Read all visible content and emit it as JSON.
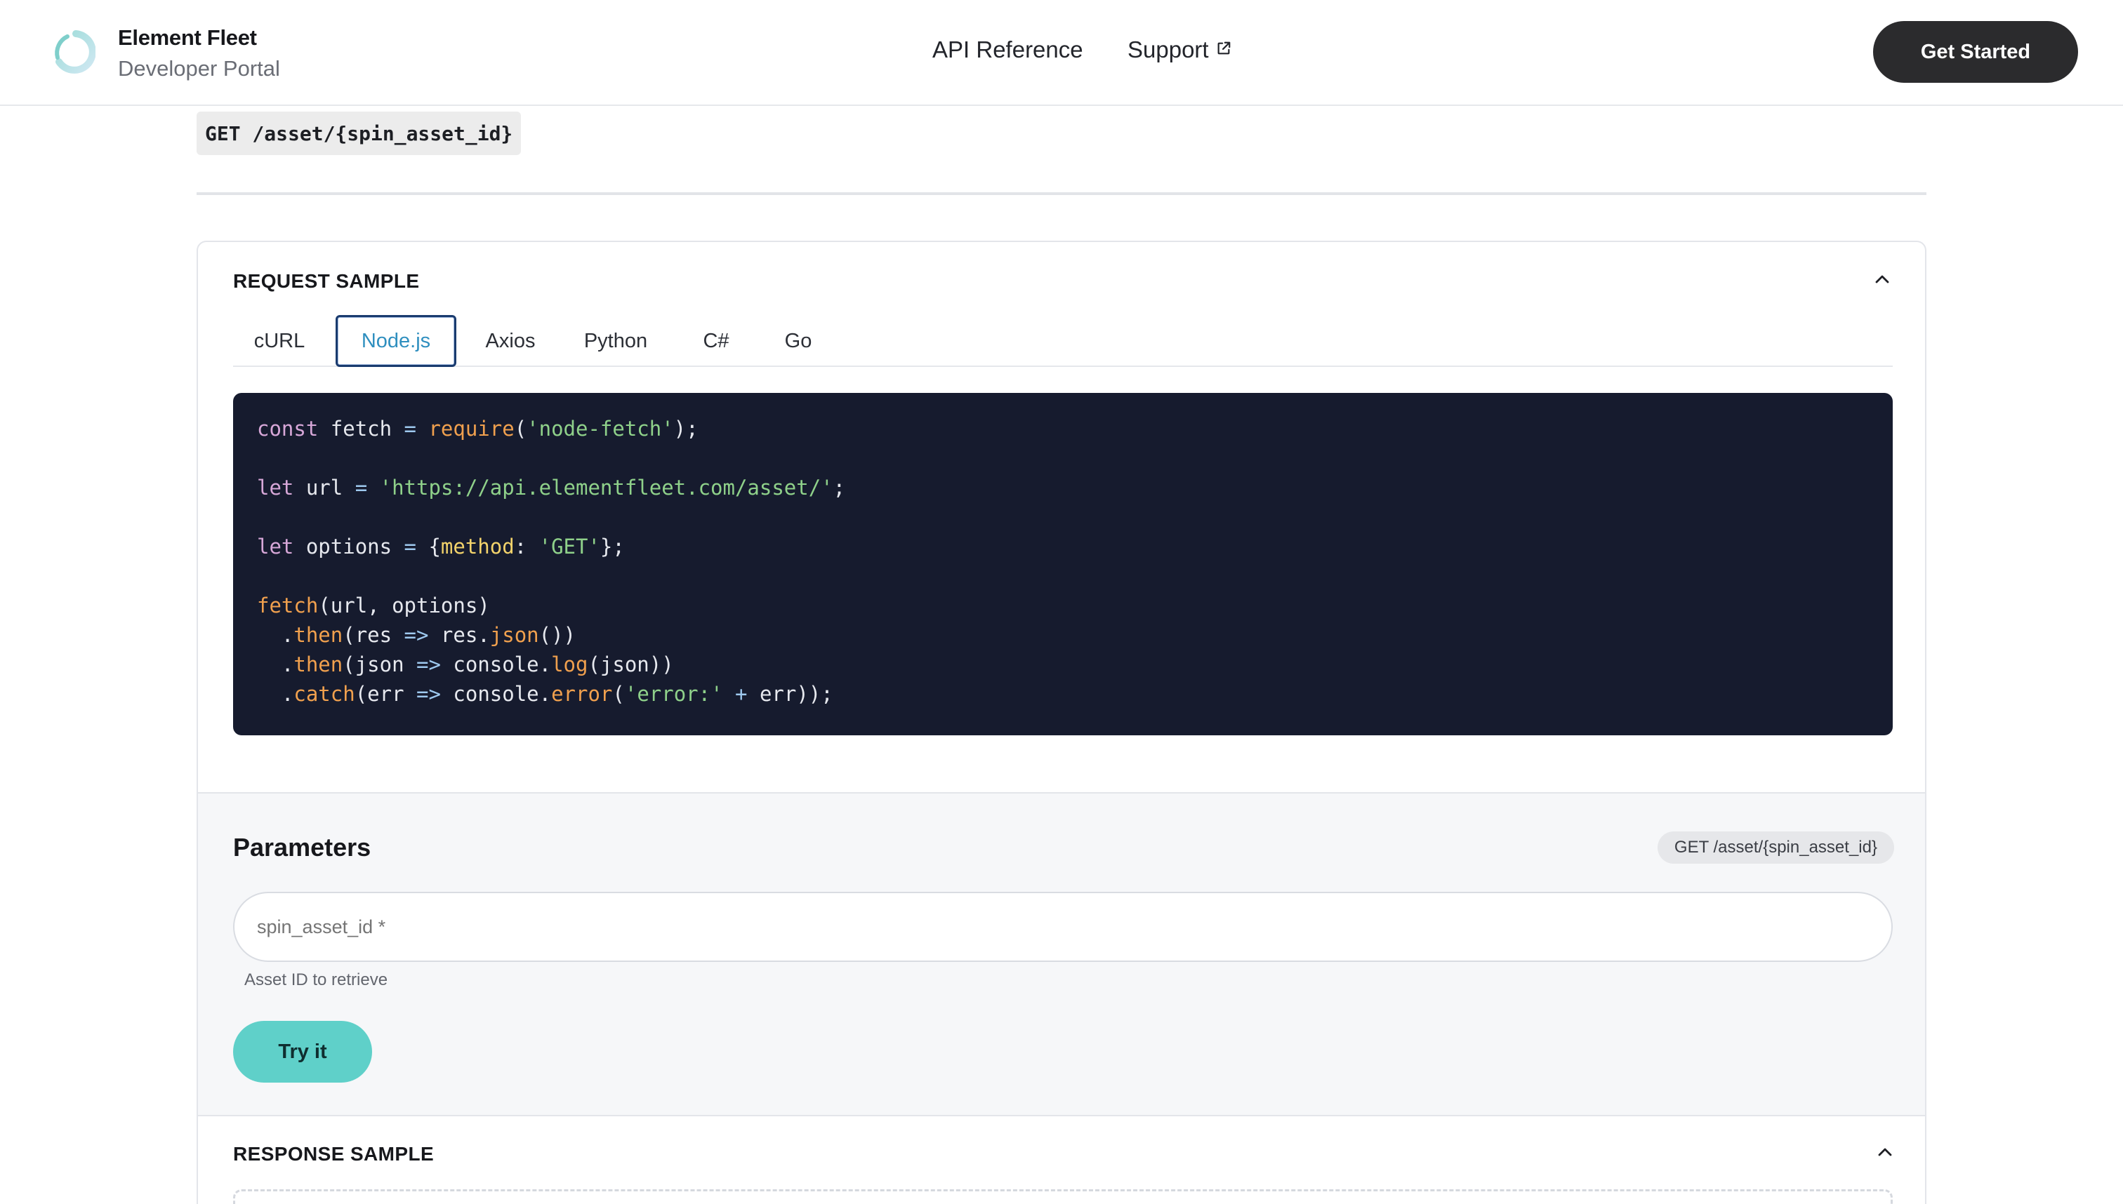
{
  "header": {
    "brand_title": "Element Fleet",
    "brand_subtitle": "Developer Portal",
    "nav": [
      {
        "label": "API Reference"
      },
      {
        "label": "Support",
        "icon": "external-link-icon"
      }
    ],
    "cta_label": "Get Started"
  },
  "endpoint": {
    "label": "GET /asset/{spin_asset_id}"
  },
  "request_sample": {
    "title": "REQUEST SAMPLE",
    "collapse_icon": "chevron-up-icon",
    "tabs": [
      {
        "label": "cURL",
        "active": false
      },
      {
        "label": "Node.js",
        "active": true
      },
      {
        "label": "Axios",
        "active": false
      },
      {
        "label": "Python",
        "active": false
      },
      {
        "label": "C#",
        "active": false
      },
      {
        "label": "Go",
        "active": false
      }
    ],
    "code": {
      "l1": {
        "kw": "const",
        "a": " fetch ",
        "op": "=",
        "b": " ",
        "fn": "require",
        "c": "(",
        "str": "'node-fetch'",
        "d": ");"
      },
      "l2": {
        "kw": "let",
        "a": " url ",
        "op": "=",
        "b": " ",
        "str": "'https://api.elementfleet.com/asset/'",
        "c": ";"
      },
      "l3": {
        "kw": "let",
        "a": " options ",
        "op": "=",
        "b": " {",
        "prop": "method",
        "c": ": ",
        "str": "'GET'",
        "d": "};"
      },
      "l4": {
        "fn": "fetch",
        "a": "(url, options)"
      },
      "l5": {
        "a": "  .",
        "fn": "then",
        "b": "(res ",
        "op": "=>",
        "c": " res.",
        "fn2": "json",
        "d": "())"
      },
      "l6": {
        "a": "  .",
        "fn": "then",
        "b": "(json ",
        "op": "=>",
        "c": " console.",
        "fn2": "log",
        "d": "(json))"
      },
      "l7": {
        "a": "  .",
        "fn": "catch",
        "b": "(err ",
        "op": "=>",
        "c": " console.",
        "fn2": "error",
        "d": "(",
        "str": "'error:'",
        "e": " ",
        "op2": "+",
        "f": " err));"
      }
    }
  },
  "parameters": {
    "title": "Parameters",
    "badge": "GET /asset/{spin_asset_id}",
    "field_placeholder": "spin_asset_id *",
    "field_value": "",
    "field_hint": "Asset ID to retrieve",
    "try_label": "Try it"
  },
  "response_sample": {
    "title": "RESPONSE SAMPLE",
    "collapse_icon": "chevron-up-icon"
  },
  "colors": {
    "cta_bg": "#2b2b2d",
    "try_bg": "#5fd0c9",
    "code_bg": "#161b2e",
    "active_tab_text": "#2f8fbf",
    "active_tab_border": "#1a3b6e"
  }
}
